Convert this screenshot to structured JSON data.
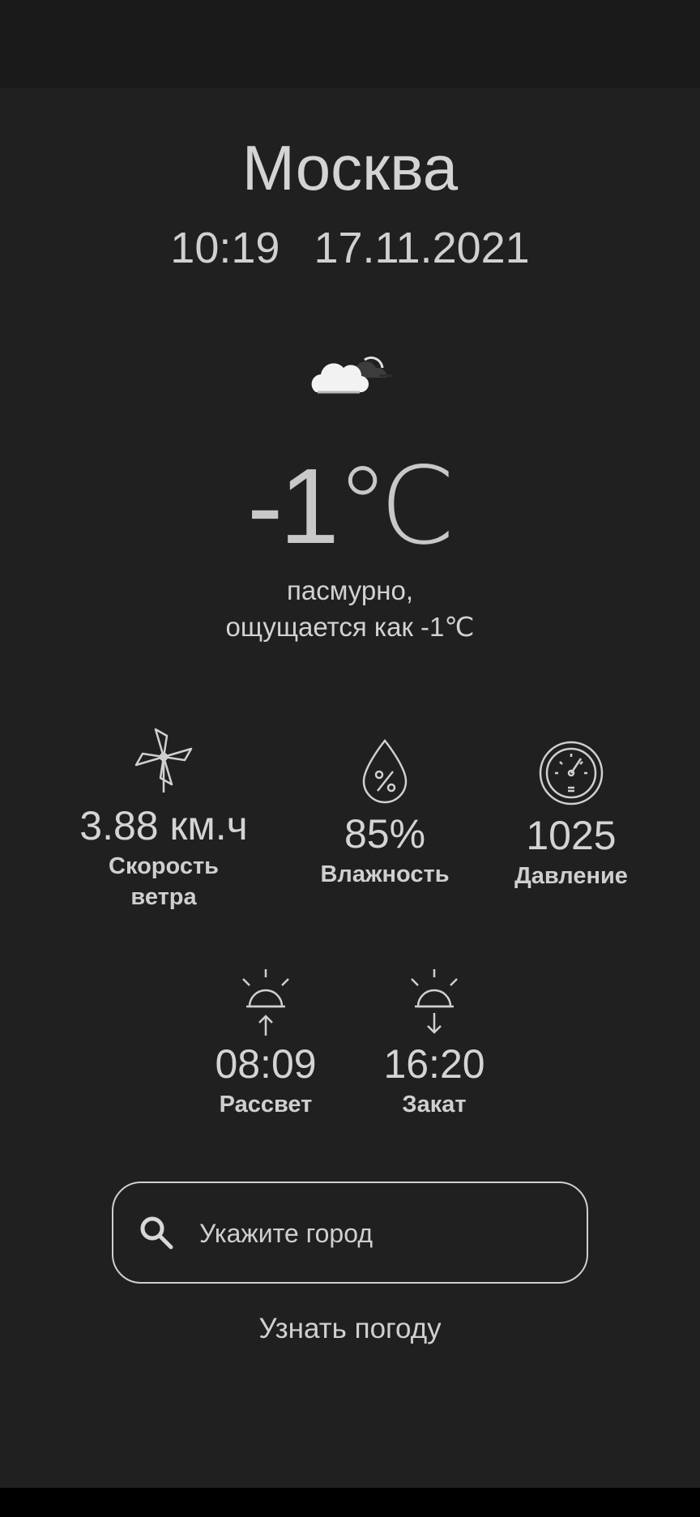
{
  "location": {
    "city": "Москва",
    "time": "10:19",
    "date": "17.11.2021"
  },
  "current": {
    "icon": "cloud-icon",
    "temperature": "-1℃",
    "condition": "пасмурно,",
    "feels_like": "ощущается как -1℃"
  },
  "stats": {
    "wind": {
      "icon": "pinwheel-icon",
      "value": "3.88 км.ч",
      "label_line1": "Скорость",
      "label_line2": "ветра"
    },
    "humidity": {
      "icon": "droplet-percent-icon",
      "value": "85%",
      "label": "Влажность"
    },
    "pressure": {
      "icon": "gauge-icon",
      "value": "1025",
      "label": "Давление"
    }
  },
  "sun": {
    "sunrise": {
      "icon": "sunrise-icon",
      "value": "08:09",
      "label": "Рассвет"
    },
    "sunset": {
      "icon": "sunset-icon",
      "value": "16:20",
      "label": "Закат"
    }
  },
  "search": {
    "placeholder": "Укажите город",
    "value": ""
  },
  "actions": {
    "fetch_label": "Узнать погоду"
  },
  "colors": {
    "background": "#202020",
    "status_bar": "#1a1a1a",
    "text": "#cfcfcf"
  }
}
